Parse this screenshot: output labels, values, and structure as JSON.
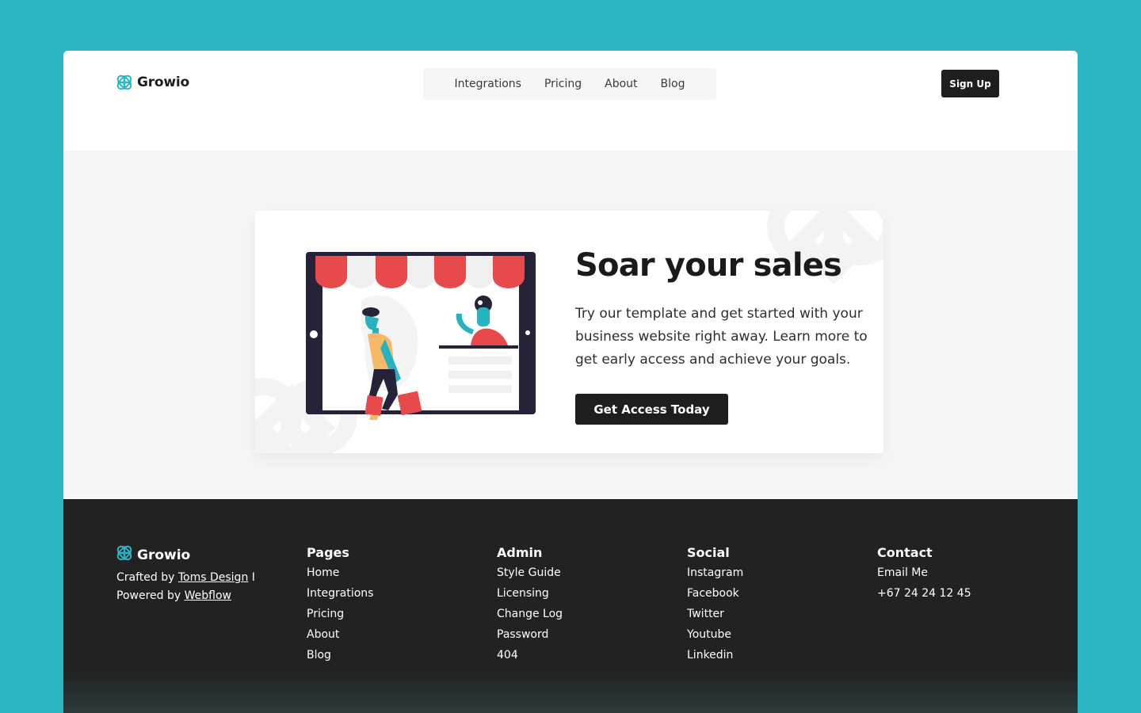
{
  "brand": {
    "name": "Growio",
    "logo_icon": "growio-logo-icon",
    "accent": "#2bb5c3"
  },
  "header": {
    "nav": [
      "Integrations",
      "Pricing",
      "About",
      "Blog"
    ],
    "signup_label": "Sign Up"
  },
  "hero": {
    "title": "Soar your sales",
    "text": "Try our template and get started with your business website right away. Learn more to get early access and achieve your goals.",
    "cta_label": "Get Access Today",
    "illustration": "storefront-illustration"
  },
  "footer": {
    "brand_name": "Growio",
    "credits": {
      "crafted_prefix": "Crafted by",
      "crafted_link": "Toms Design",
      "separator": "I",
      "powered_prefix": "Powered by",
      "powered_link": "Webflow"
    },
    "columns": [
      {
        "title": "Pages",
        "links": [
          "Home",
          "Integrations",
          "Pricing",
          "About",
          "Blog"
        ]
      },
      {
        "title": "Admin",
        "links": [
          "Style Guide",
          "Licensing",
          "Change Log",
          "Password",
          "404"
        ]
      },
      {
        "title": "Social",
        "links": [
          "Instagram",
          "Facebook",
          "Twitter",
          "Youtube",
          "Linkedin"
        ]
      },
      {
        "title": "Contact",
        "links": [
          "Email Me",
          "+67 24 24 12 45"
        ]
      }
    ]
  },
  "colors": {
    "page_background": "#2bb5c3",
    "dark": "#1e1e1e",
    "hero_background": "#f6f6f6",
    "awning_red": "#e8494a"
  }
}
